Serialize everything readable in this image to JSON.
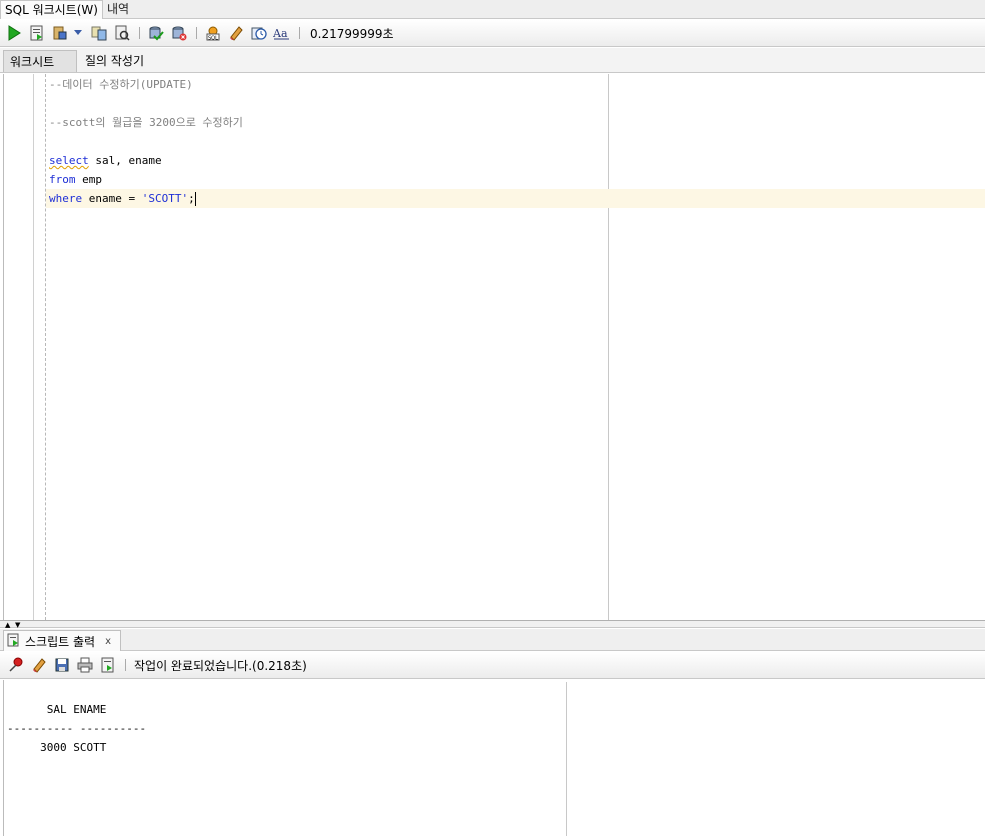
{
  "top_tabs": {
    "worksheet": "SQL 워크시트(W)",
    "history": "내역"
  },
  "toolbar": {
    "exec_time": "0.21799999초"
  },
  "sub_tabs": {
    "worksheet": "워크시트",
    "query_builder": "질의 작성기"
  },
  "editor": {
    "line1": "--데이터 수정하기(UPDATE)",
    "line3": "--scott의 월급을 3200으로 수정하기",
    "line5_kw": "select",
    "line5_rest": " sal, ename",
    "line6_kw": "from",
    "line6_rest": " emp",
    "line7_kw": "where",
    "line7_mid": " ename = ",
    "line7_str": "'SCOTT'",
    "line7_end": ";"
  },
  "output": {
    "tab_label": "스크립트 출력",
    "close_label": "x",
    "message": "작업이 완료되었습니다.(0.218초)",
    "result_lines": [
      "      SAL ENAME",
      "---------- ----------",
      "     3000 SCOTT"
    ]
  },
  "colors": {
    "keyword": "#1e2fd6",
    "comment": "#808080",
    "current_line": "#fdf7e4"
  },
  "icons": [
    "run-statement-icon",
    "run-script-icon",
    "commit-icon",
    "rollback-icon",
    "autotrace-icon",
    "explain-plan-icon",
    "sql-tuning-icon",
    "clear-icon",
    "history-icon",
    "format-case-icon",
    "pin-icon",
    "eraser-icon",
    "save-icon",
    "print-icon",
    "output-to-file-icon"
  ]
}
